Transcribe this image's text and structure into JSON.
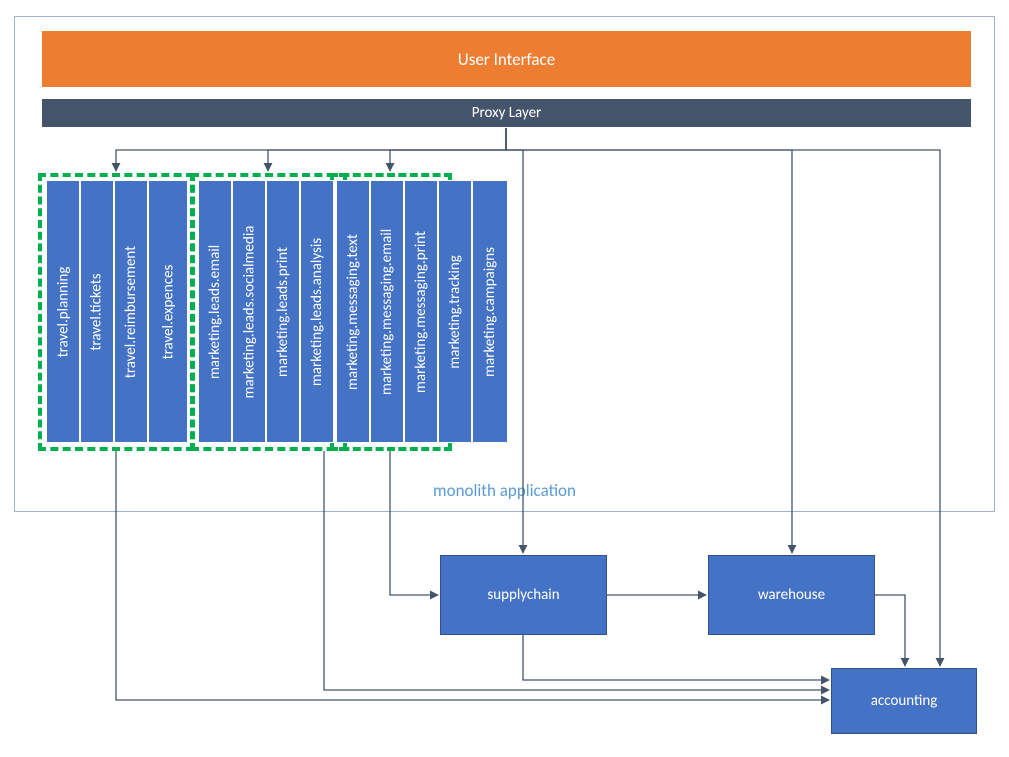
{
  "layers": {
    "ui": "User Interface",
    "proxy": "Proxy Layer",
    "monolith": "monolith application"
  },
  "travel": [
    "travel.planning",
    "travel.tickets",
    "travel.reimbursement",
    "travel.expences"
  ],
  "marketing": [
    "marketing.leads.email",
    "marketing.leads.socialmedia",
    "marketing.leads.print",
    "marketing.leads.analysis",
    "marketing.messaging.text",
    "marketing.messaging.email",
    "marketing.messaging.print",
    "marketing.tracking",
    "marketing.campaigns"
  ],
  "services": {
    "supplychain": "supplychain",
    "warehouse": "warehouse",
    "accounting": "accounting"
  },
  "colors": {
    "ui": "#ED7D31",
    "proxy": "#44546A",
    "dash": "#00B050",
    "block": "#4472C4",
    "arrow": "#44546A",
    "monoBorder": "#5B9BD5"
  }
}
